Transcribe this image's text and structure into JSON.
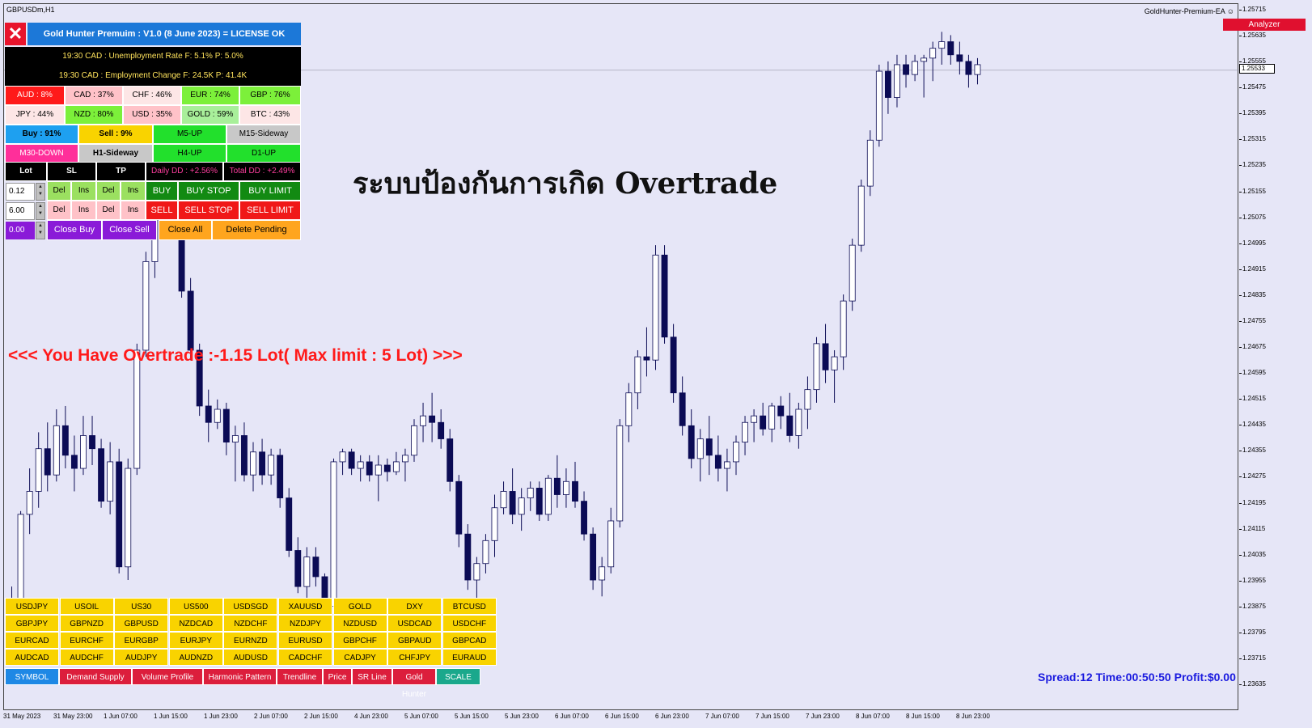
{
  "chart": {
    "symbol_title": "GBPUSDm,H1",
    "ea_name": "GoldHunter-Premium-EA",
    "ea_icon": "smiley-icon",
    "analyzer_label": "Analyzer",
    "current_price": "1.25533",
    "price_ticks": [
      "1.25715",
      "1.25635",
      "1.25555",
      "1.25475",
      "1.25395",
      "1.25315",
      "1.25235",
      "1.25155",
      "1.25075",
      "1.24995",
      "1.24915",
      "1.24835",
      "1.24755",
      "1.24675",
      "1.24595",
      "1.24515",
      "1.24435",
      "1.24355",
      "1.24275",
      "1.24195",
      "1.24115",
      "1.24035",
      "1.23955",
      "1.23875",
      "1.23795",
      "1.23715",
      "1.23635"
    ],
    "time_ticks": [
      "31 May 2023",
      "31 May 23:00",
      "1 Jun 07:00",
      "1 Jun 15:00",
      "1 Jun 23:00",
      "2 Jun 07:00",
      "2 Jun 15:00",
      "4 Jun 23:00",
      "5 Jun 07:00",
      "5 Jun 15:00",
      "5 Jun 23:00",
      "6 Jun 07:00",
      "6 Jun 15:00",
      "6 Jun 23:00",
      "7 Jun 07:00",
      "7 Jun 15:00",
      "7 Jun 23:00",
      "8 Jun 07:00",
      "8 Jun 15:00",
      "8 Jun 23:00"
    ],
    "colors": {
      "bear": "#0b0b55",
      "bull": "#ffffff",
      "background": "#e6e6f7"
    }
  },
  "overlay": {
    "thai_text": "ระบบป้องกันการเกิด Overtrade",
    "overtrade_warning": "<<< You Have Overtrade :-1.15 Lot( Max limit : 5 Lot) >>>",
    "status_line": "Spread:12 Time:00:50:50 Profit:$0.00"
  },
  "panel": {
    "close_label": "✕",
    "title": "Gold Hunter Premuim : V1.0 (8 June 2023) = LICENSE OK",
    "news": [
      "19:30 CAD : Unemployment Rate  F: 5.1% P: 5.0%",
      "19:30 CAD : Employment Change  F: 24.5K P: 41.4K"
    ],
    "currency_strength": [
      {
        "label": "AUD : 8%",
        "color": "#ff1a1a",
        "text": "#fff"
      },
      {
        "label": "CAD : 37%",
        "color": "#ffc2c8",
        "text": "#000"
      },
      {
        "label": "CHF : 46%",
        "color": "#fde6e6",
        "text": "#000"
      },
      {
        "label": "EUR : 74%",
        "color": "#7cf03a",
        "text": "#000"
      },
      {
        "label": "GBP : 76%",
        "color": "#7cf03a",
        "text": "#000"
      },
      {
        "label": "JPY : 44%",
        "color": "#fde6e6",
        "text": "#000"
      },
      {
        "label": "NZD : 80%",
        "color": "#7cf03a",
        "text": "#000"
      },
      {
        "label": "USD : 35%",
        "color": "#ffc2c8",
        "text": "#000"
      },
      {
        "label": "GOLD : 59%",
        "color": "#a8ef9a",
        "text": "#000"
      },
      {
        "label": "BTC : 43%",
        "color": "#fde6e6",
        "text": "#000"
      }
    ],
    "signals": [
      {
        "label": "Buy : 91%",
        "color": "#1ea0f0",
        "text": "#000",
        "bold": true
      },
      {
        "label": "Sell : 9%",
        "color": "#f9d300",
        "text": "#000",
        "bold": true
      },
      {
        "label": "M5-UP",
        "color": "#22e02c",
        "text": "#000",
        "bold": false
      },
      {
        "label": "M15-Sideway",
        "color": "#c8c8c8",
        "text": "#000",
        "bold": false
      },
      {
        "label": "M30-DOWN",
        "color": "#ff2f9a",
        "text": "#fff",
        "bold": false
      },
      {
        "label": "H1-Sideway",
        "color": "#c8c8c8",
        "text": "#000",
        "bold": true
      },
      {
        "label": "H4-UP",
        "color": "#22e02c",
        "text": "#000",
        "bold": false
      },
      {
        "label": "D1-UP",
        "color": "#22e02c",
        "text": "#000",
        "bold": false
      }
    ],
    "headers": {
      "lot": "Lot",
      "sl": "SL",
      "tp": "TP",
      "daily_dd": "Daily DD : +2.56%",
      "total_dd": "Total DD : +2.49%"
    },
    "lot_value": "0.12",
    "sl_value": "6.00",
    "tp_value": "0.00",
    "del_label": "Del",
    "ins_label": "Ins",
    "buy": "BUY",
    "buy_stop": "BUY STOP",
    "buy_limit": "BUY LIMIT",
    "sell": "SELL",
    "sell_stop": "SELL STOP",
    "sell_limit": "SELL LIMIT",
    "close_buy": "Close Buy",
    "close_sell": "Close Sell",
    "close_all": "Close All",
    "delete_pending": "Delete Pending"
  },
  "symbols": [
    [
      "USDJPY",
      "USOIL",
      "US30",
      "US500",
      "USDSGD",
      "XAUUSD",
      "GOLD",
      "DXY",
      "BTCUSD"
    ],
    [
      "GBPJPY",
      "GBPNZD",
      "GBPUSD",
      "NZDCAD",
      "NZDCHF",
      "NZDJPY",
      "NZDUSD",
      "USDCAD",
      "USDCHF"
    ],
    [
      "EURCAD",
      "EURCHF",
      "EURGBP",
      "EURJPY",
      "EURNZD",
      "EURUSD",
      "GBPCHF",
      "GBPAUD",
      "GBPCAD"
    ],
    [
      "AUDCAD",
      "AUDCHF",
      "AUDJPY",
      "AUDNZD",
      "AUDUSD",
      "CADCHF",
      "CADJPY",
      "CHFJPY",
      "EURAUD"
    ]
  ],
  "toolbar": [
    {
      "label": "SYMBOL",
      "color": "#1e88e5"
    },
    {
      "label": "Demand Supply",
      "color": "#dc1e3c"
    },
    {
      "label": "Volume Profile",
      "color": "#dc1e3c"
    },
    {
      "label": "Harmonic Pattern",
      "color": "#dc1e3c"
    },
    {
      "label": "Trendline",
      "color": "#dc1e3c"
    },
    {
      "label": "Price",
      "color": "#dc1e3c"
    },
    {
      "label": "SR Line",
      "color": "#dc1e3c"
    },
    {
      "label": "Gold Hunter",
      "color": "#dc1e3c"
    },
    {
      "label": "SCALE",
      "color": "#1aa88c"
    }
  ],
  "candles": [
    [
      1.2382,
      1.2396,
      1.2372,
      1.2392
    ],
    [
      1.2392,
      1.2419,
      1.2388,
      1.2418
    ],
    [
      1.2418,
      1.2432,
      1.2412,
      1.2425
    ],
    [
      1.2425,
      1.2443,
      1.242,
      1.2438
    ],
    [
      1.2438,
      1.2446,
      1.2425,
      1.243
    ],
    [
      1.243,
      1.245,
      1.2428,
      1.2445
    ],
    [
      1.2445,
      1.2451,
      1.2432,
      1.2436
    ],
    [
      1.2436,
      1.2442,
      1.2425,
      1.2432
    ],
    [
      1.2432,
      1.2448,
      1.243,
      1.2442
    ],
    [
      1.2442,
      1.2448,
      1.2433,
      1.2438
    ],
    [
      1.2438,
      1.2441,
      1.242,
      1.2422
    ],
    [
      1.2422,
      1.244,
      1.2418,
      1.2434
    ],
    [
      1.2434,
      1.2438,
      1.24,
      1.2402
    ],
    [
      1.2402,
      1.2435,
      1.2398,
      1.2432
    ],
    [
      1.2432,
      1.247,
      1.243,
      1.2468
    ],
    [
      1.2468,
      1.2498,
      1.2466,
      1.2495
    ],
    [
      1.2495,
      1.2515,
      1.249,
      1.2512
    ],
    [
      1.2512,
      1.253,
      1.2505,
      1.2525
    ],
    [
      1.2525,
      1.2533,
      1.251,
      1.2512
    ],
    [
      1.2512,
      1.2515,
      1.2484,
      1.2486
    ],
    [
      1.2486,
      1.249,
      1.2465,
      1.2468
    ],
    [
      1.2468,
      1.247,
      1.2448,
      1.2451
    ],
    [
      1.2451,
      1.2456,
      1.244,
      1.2446
    ],
    [
      1.2446,
      1.2453,
      1.2444,
      1.245
    ],
    [
      1.245,
      1.2452,
      1.2436,
      1.244
    ],
    [
      1.244,
      1.2445,
      1.2428,
      1.2442
    ],
    [
      1.2442,
      1.2446,
      1.2428,
      1.243
    ],
    [
      1.243,
      1.244,
      1.2425,
      1.2437
    ],
    [
      1.2437,
      1.2441,
      1.2427,
      1.243
    ],
    [
      1.243,
      1.2438,
      1.2427,
      1.2436
    ],
    [
      1.2436,
      1.2438,
      1.242,
      1.2423
    ],
    [
      1.2423,
      1.2426,
      1.2405,
      1.2407
    ],
    [
      1.2407,
      1.2411,
      1.2394,
      1.2396
    ],
    [
      1.2396,
      1.2408,
      1.2391,
      1.2405
    ],
    [
      1.2405,
      1.2408,
      1.2396,
      1.2399
    ],
    [
      1.2399,
      1.24,
      1.2388,
      1.239
    ],
    [
      1.239,
      1.2435,
      1.2388,
      1.2434
    ],
    [
      1.2434,
      1.2438,
      1.243,
      1.2437
    ],
    [
      1.2437,
      1.2438,
      1.243,
      1.2432
    ],
    [
      1.2432,
      1.2436,
      1.2428,
      1.2434
    ],
    [
      1.2434,
      1.2436,
      1.2428,
      1.243
    ],
    [
      1.243,
      1.2436,
      1.2422,
      1.2433
    ],
    [
      1.2433,
      1.2435,
      1.2428,
      1.2431
    ],
    [
      1.2431,
      1.2437,
      1.243,
      1.2434
    ],
    [
      1.2434,
      1.2438,
      1.2428,
      1.2436
    ],
    [
      1.2436,
      1.2447,
      1.2434,
      1.2445
    ],
    [
      1.2445,
      1.2452,
      1.244,
      1.2448
    ],
    [
      1.2448,
      1.2455,
      1.244,
      1.2446
    ],
    [
      1.2446,
      1.245,
      1.2438,
      1.2441
    ],
    [
      1.2441,
      1.2444,
      1.2425,
      1.2428
    ],
    [
      1.2428,
      1.243,
      1.2408,
      1.2412
    ],
    [
      1.2412,
      1.2415,
      1.2395,
      1.2398
    ],
    [
      1.2398,
      1.2405,
      1.2392,
      1.2403
    ],
    [
      1.2403,
      1.2412,
      1.24,
      1.241
    ],
    [
      1.241,
      1.2424,
      1.2405,
      1.242
    ],
    [
      1.242,
      1.2428,
      1.2418,
      1.2425
    ],
    [
      1.2425,
      1.2432,
      1.2415,
      1.2418
    ],
    [
      1.2418,
      1.2426,
      1.2413,
      1.2423
    ],
    [
      1.2423,
      1.2428,
      1.2419,
      1.2426
    ],
    [
      1.2426,
      1.2428,
      1.2416,
      1.2418
    ],
    [
      1.2418,
      1.243,
      1.2416,
      1.2429
    ],
    [
      1.2429,
      1.2436,
      1.242,
      1.2424
    ],
    [
      1.2424,
      1.2432,
      1.242,
      1.2428
    ],
    [
      1.2428,
      1.2434,
      1.242,
      1.2422
    ],
    [
      1.2422,
      1.2425,
      1.241,
      1.2412
    ],
    [
      1.2412,
      1.2414,
      1.2395,
      1.2398
    ],
    [
      1.2398,
      1.2405,
      1.2393,
      1.2402
    ],
    [
      1.2402,
      1.242,
      1.24,
      1.2416
    ],
    [
      1.2416,
      1.2447,
      1.2414,
      1.2445
    ],
    [
      1.2445,
      1.2458,
      1.244,
      1.2455
    ],
    [
      1.2455,
      1.2468,
      1.245,
      1.2466
    ],
    [
      1.2466,
      1.2475,
      1.246,
      1.2465
    ],
    [
      1.2465,
      1.25,
      1.2462,
      1.2497
    ],
    [
      1.2497,
      1.25,
      1.247,
      1.2472
    ],
    [
      1.2472,
      1.2476,
      1.2452,
      1.2455
    ],
    [
      1.2455,
      1.246,
      1.2442,
      1.2445
    ],
    [
      1.2445,
      1.245,
      1.2432,
      1.2435
    ],
    [
      1.2435,
      1.2444,
      1.2428,
      1.2441
    ],
    [
      1.2441,
      1.2448,
      1.243,
      1.2436
    ],
    [
      1.2436,
      1.2442,
      1.2428,
      1.2432
    ],
    [
      1.2432,
      1.2438,
      1.2425,
      1.2434
    ],
    [
      1.2434,
      1.2442,
      1.243,
      1.244
    ],
    [
      1.244,
      1.2448,
      1.2436,
      1.2446
    ],
    [
      1.2446,
      1.245,
      1.244,
      1.2448
    ],
    [
      1.2448,
      1.2452,
      1.2442,
      1.2444
    ],
    [
      1.2444,
      1.2452,
      1.244,
      1.2451
    ],
    [
      1.2451,
      1.2454,
      1.2444,
      1.2448
    ],
    [
      1.2448,
      1.2455,
      1.244,
      1.2442
    ],
    [
      1.2442,
      1.2452,
      1.2438,
      1.245
    ],
    [
      1.245,
      1.246,
      1.2444,
      1.2456
    ],
    [
      1.2456,
      1.2472,
      1.2452,
      1.247
    ],
    [
      1.247,
      1.2476,
      1.2458,
      1.2462
    ],
    [
      1.2462,
      1.2468,
      1.2452,
      1.2466
    ],
    [
      1.2466,
      1.2485,
      1.2462,
      1.2483
    ],
    [
      1.2483,
      1.2502,
      1.248,
      1.25
    ],
    [
      1.25,
      1.252,
      1.2498,
      1.2518
    ],
    [
      1.2518,
      1.2535,
      1.2515,
      1.2532
    ],
    [
      1.2532,
      1.2555,
      1.253,
      1.2553
    ],
    [
      1.2553,
      1.2556,
      1.254,
      1.2545
    ],
    [
      1.2545,
      1.2558,
      1.2542,
      1.2555
    ],
    [
      1.2555,
      1.2558,
      1.2548,
      1.2552
    ],
    [
      1.2552,
      1.2558,
      1.255,
      1.2556
    ],
    [
      1.2556,
      1.2558,
      1.2545,
      1.2557
    ],
    [
      1.2557,
      1.2562,
      1.255,
      1.256
    ],
    [
      1.256,
      1.2565,
      1.2555,
      1.2562
    ],
    [
      1.2562,
      1.2564,
      1.2555,
      1.2558
    ],
    [
      1.2558,
      1.2562,
      1.2552,
      1.2556
    ],
    [
      1.2556,
      1.2558,
      1.2548,
      1.2552
    ],
    [
      1.2552,
      1.2557,
      1.2549,
      1.2555
    ]
  ]
}
